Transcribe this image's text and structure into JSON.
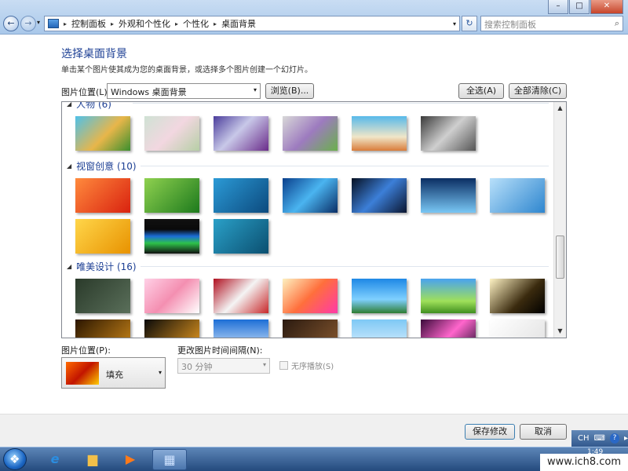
{
  "window": {
    "back": "←",
    "forward": "→",
    "history_dd": "▾",
    "minimize": "–",
    "maximize": "□",
    "close": "✕"
  },
  "address": {
    "icon": "control-panel-icon",
    "crumbs": [
      "控制面板",
      "外观和个性化",
      "个性化",
      "桌面背景"
    ],
    "dd": "▾"
  },
  "refresh_glyph": "↻",
  "search": {
    "placeholder": "搜索控制面板",
    "icon_glyph": "⌕"
  },
  "page": {
    "title": "选择桌面背景",
    "subtitle": "单击某个图片使其成为您的桌面背景，或选择多个图片创建一个幻灯片。"
  },
  "location": {
    "label": "图片位置(L):",
    "value": "Windows 桌面背景",
    "browse": "浏览(B)...",
    "select_all": "全选(A)",
    "clear_all": "全部清除(C)"
  },
  "groups": [
    {
      "title": "人物 (6)",
      "collapsed_glyph": "◢"
    },
    {
      "title": "视窗创意 (10)",
      "collapsed_glyph": "◢"
    },
    {
      "title": "唯美设计 (16)",
      "collapsed_glyph": "◢"
    }
  ],
  "thumbnails_row1": [
    "linear-gradient(135deg,#4fc1e9,#e8b64a 55%,#3b8f2e)",
    "linear-gradient(135deg,#cfe2d4,#f2d7e0 50%,#b6cfa6)",
    "linear-gradient(135deg,#4b3d9c,#c8c8e8 45%,#6a2c8a)",
    "linear-gradient(135deg,#d8d8d8,#9d7bbf 50%,#6ab04c)",
    "linear-gradient(180deg,#57b9ea,#f0e6c8 60%,#d97c3a)",
    "linear-gradient(135deg,#3a3a3a,#cfcfcf 50%,#555)"
  ],
  "thumbnails_row2": [
    "linear-gradient(135deg,#ff8a3d,#d9220f)",
    "linear-gradient(135deg,#8fd14f,#1d7a1d)",
    "linear-gradient(135deg,#2b9ad6,#0c4a7e)",
    "linear-gradient(135deg,#0a3f8c,#4ab4f0 50%,#0a2e66)",
    "linear-gradient(135deg,#061022,#3c7fd8 50%,#0b1630)",
    "linear-gradient(180deg,#0b2e63,#79c7f5)",
    "linear-gradient(135deg,#b8e0fa,#2e86cf)"
  ],
  "thumbnails_row3": [
    "linear-gradient(135deg,#ffd64a,#e89200)",
    "linear-gradient(180deg,#111,#0a0a0a 30%,#1b6dd8 50%,#2ec24a 70%,#111)",
    "linear-gradient(135deg,#2aa0c8,#0b4f70)"
  ],
  "thumbnails_row4": [
    "linear-gradient(135deg,#2a3a2a,#5a6f5a)",
    "linear-gradient(135deg,#ffd0e6,#f48fb1 50%,#fff)",
    "linear-gradient(135deg,#b01020,#f4f4f4 50%,#c8282a)",
    "linear-gradient(135deg,#fdf1c0,#ff6f3c 50%,#ff3aa8)",
    "linear-gradient(180deg,#1e88e5,#7fd0ff 60%,#2e7d32)",
    "linear-gradient(180deg,#4aa3f0,#9fe05a 65%,#3f8f1f)",
    "linear-gradient(135deg,#fff3c4,#3a2a0e 60%,#000)"
  ],
  "thumbnails_row5": [
    "linear-gradient(135deg,#2b1600,#d08a1a)",
    "linear-gradient(135deg,#0a0a0a,#f0a020)",
    "linear-gradient(180deg,#1c6fd6,#e8f2ff)",
    "linear-gradient(135deg,#2a1a10,#8a5a30)",
    "linear-gradient(180deg,#7ec8f5,#eaf6ff)",
    "linear-gradient(135deg,#3a0a3a,#ff66cc 50%,#1a0a2a)",
    "linear-gradient(135deg,#ffffff,#e0e0e0)"
  ],
  "scroll": {
    "up": "▲",
    "down": "▼"
  },
  "position": {
    "label": "图片位置(P):",
    "value": "填充",
    "dd": "▾"
  },
  "interval": {
    "label": "更改图片时间间隔(N):",
    "value": "30 分钟",
    "dd": "▾"
  },
  "shuffle_label": "无序播放(S)",
  "actions": {
    "save": "保存修改",
    "cancel": "取消"
  },
  "taskbar": {
    "items": [
      {
        "glyph": "e",
        "color": "#2b8de0"
      },
      {
        "glyph": "▆",
        "color": "#f2c04a"
      },
      {
        "glyph": "▶",
        "color": "#ff7a1a"
      },
      {
        "glyph": "▦",
        "color": "#cfe3ff"
      }
    ],
    "tray_lang": "CH",
    "tray_kb": "⌨",
    "tray_help": "?",
    "tray_more": "▸",
    "clock": "1:49"
  },
  "watermark": "www.ich8.com"
}
